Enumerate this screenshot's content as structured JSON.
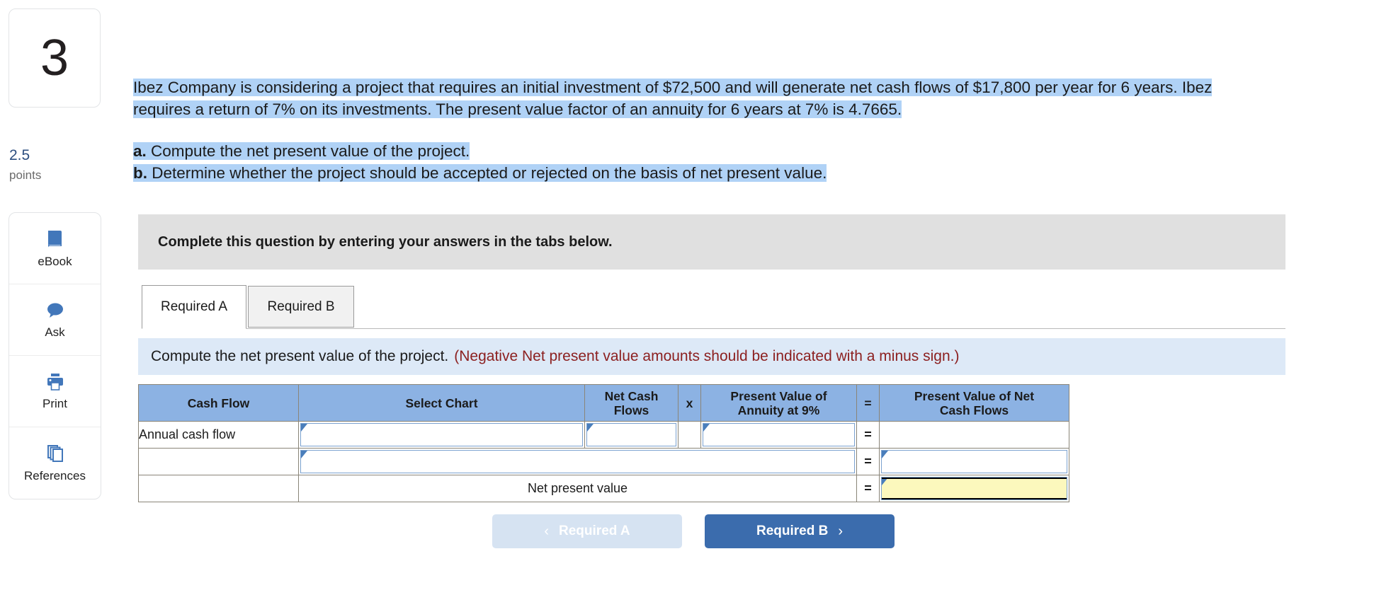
{
  "question": {
    "number": "3",
    "points_value": "2.5",
    "points_label": "points",
    "body_line1": "Ibez Company is considering a project that requires an initial investment of $72,500 and will generate net cash flows of $17,800 per year for 6 years. Ibez requires a return of 7% on its investments. The present value factor of an annuity for 6 years at 7% is 4.7665.",
    "part_a_marker": "a.",
    "part_a_text": "Compute the net present value of the project.",
    "part_b_marker": "b.",
    "part_b_text": "Determine whether the project should be accepted or rejected on the basis of net present value."
  },
  "tools": [
    {
      "icon": "ebook-icon",
      "label": "eBook"
    },
    {
      "icon": "ask-chat-icon",
      "label": "Ask"
    },
    {
      "icon": "print-icon",
      "label": "Print"
    },
    {
      "icon": "references-icon",
      "label": "References"
    }
  ],
  "instruction_bar": {
    "text": "Complete this question by entering your answers in the tabs below."
  },
  "tabs": [
    {
      "label": "Required A",
      "active": true
    },
    {
      "label": "Required B",
      "active": false
    }
  ],
  "prompt": {
    "main": "Compute the net present value of the project.",
    "note": "(Negative Net present value amounts should be indicated with a minus sign.)"
  },
  "table": {
    "headers": [
      "Cash Flow",
      "Select Chart",
      "Net Cash Flows",
      "x",
      "Present Value of Annuity at 9%",
      "=",
      "Present Value of Net Cash Flows"
    ],
    "header_lines": {
      "net_cash_flows_l1": "Net Cash",
      "net_cash_flows_l2": "Flows",
      "pv_annuity_l1": "Present Value of",
      "pv_annuity_l2": "Annuity at 9%",
      "pv_net_l1": "Present Value of Net",
      "pv_net_l2": "Cash Flows"
    },
    "rows": [
      {
        "cash_flow": "Annual cash flow",
        "select_chart": "",
        "net_cash_flows": "",
        "x": "",
        "pv_annuity": "",
        "eq": "=",
        "pv_net_cash_flows": ""
      },
      {
        "cash_flow": "",
        "select_chart": "",
        "eq": "=",
        "pv_net_cash_flows": ""
      },
      {
        "cash_flow": "",
        "label_span": "Net present value",
        "eq": "=",
        "pv_net_cash_flows": ""
      }
    ]
  },
  "nav": {
    "prev_label": "Required A",
    "prev_chevron": "‹",
    "next_label": "Required B",
    "next_chevron": "›"
  },
  "colors": {
    "header_blue": "#8cb2e3",
    "highlight_blue": "#b0d2f6",
    "prompt_bg": "#dde9f7",
    "note_red": "#8c2020",
    "primary_button": "#3b6cad",
    "answer_yellow": "#fcf8bd",
    "icon_blue": "#4277ba",
    "points_blue": "#2d4f80"
  }
}
